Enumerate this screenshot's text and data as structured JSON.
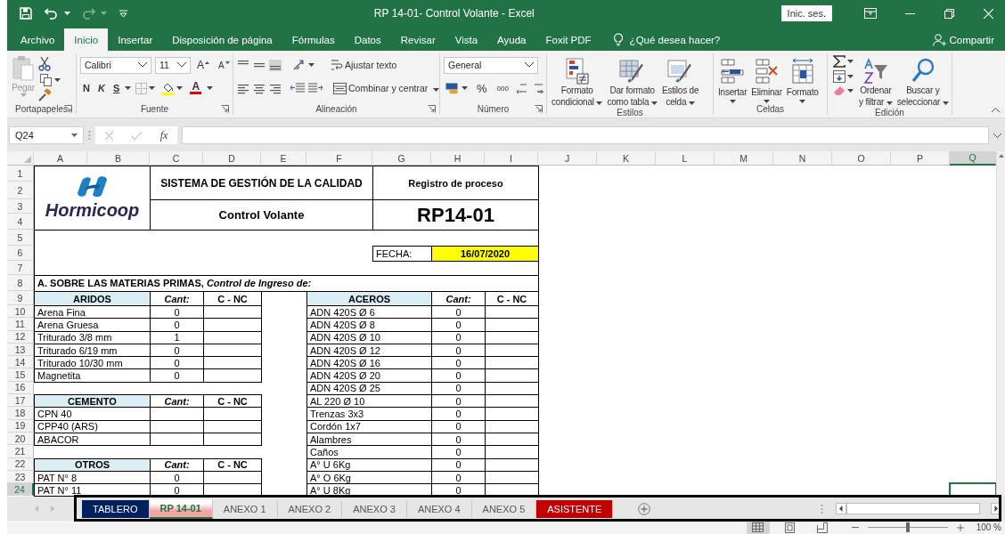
{
  "window": {
    "title": "RP 14-01- Control Volante  -  Excel",
    "sign_in": "Inic. ses."
  },
  "ribbon_tabs": [
    {
      "label": "Archivo",
      "selected": false
    },
    {
      "label": "Inicio",
      "selected": true
    },
    {
      "label": "Insertar",
      "selected": false
    },
    {
      "label": "Disposición de página",
      "selected": false
    },
    {
      "label": "Fórmulas",
      "selected": false
    },
    {
      "label": "Datos",
      "selected": false
    },
    {
      "label": "Revisar",
      "selected": false
    },
    {
      "label": "Vista",
      "selected": false
    },
    {
      "label": "Ayuda",
      "selected": false
    },
    {
      "label": "Foxit PDF",
      "selected": false
    }
  ],
  "tell_me": "¿Qué desea hacer?",
  "share": "Compartir",
  "ribbon": {
    "clipboard": {
      "label": "Portapapeles",
      "paste": "Pegar"
    },
    "font": {
      "label": "Fuente",
      "family": "Calibri",
      "size": "11",
      "grow": "A",
      "shrink": "A",
      "bold": "N",
      "italic": "K",
      "underline": "S",
      "color_letter": "A"
    },
    "alignment": {
      "label": "Alineación",
      "wrap": "Ajustar texto",
      "merge": "Combinar y centrar"
    },
    "number": {
      "label": "Número",
      "format": "General",
      "percent": "%",
      "thousands": "000"
    },
    "styles": {
      "label": "Estilos",
      "buttons": [
        {
          "lines": [
            "Formato",
            "condicional"
          ]
        },
        {
          "lines": [
            "Dar formato",
            "como tabla"
          ]
        },
        {
          "lines": [
            "Estilos de",
            "celda"
          ]
        }
      ]
    },
    "cells": {
      "label": "Celdas",
      "buttons": [
        "Insertar",
        "Eliminar",
        "Formato"
      ]
    },
    "editing": {
      "label": "Edición",
      "buttons": [
        {
          "lines": [
            "Ordenar",
            "y filtrar"
          ]
        },
        {
          "lines": [
            "Buscar y",
            "seleccionar"
          ]
        }
      ]
    }
  },
  "formula_bar": {
    "name_box": "Q24",
    "function_label": "fx"
  },
  "columns": [
    {
      "label": "A",
      "selected": false
    },
    {
      "label": "B",
      "selected": false
    },
    {
      "label": "C",
      "selected": false
    },
    {
      "label": "D",
      "selected": false
    },
    {
      "label": "E",
      "selected": false
    },
    {
      "label": "F",
      "selected": false
    },
    {
      "label": "G",
      "selected": false
    },
    {
      "label": "H",
      "selected": false
    },
    {
      "label": "I",
      "selected": false
    },
    {
      "label": "J",
      "selected": false
    },
    {
      "label": "K",
      "selected": false
    },
    {
      "label": "L",
      "selected": false
    },
    {
      "label": "M",
      "selected": false
    },
    {
      "label": "N",
      "selected": false
    },
    {
      "label": "O",
      "selected": false
    },
    {
      "label": "P",
      "selected": false
    },
    {
      "label": "Q",
      "selected": true
    }
  ],
  "row_numbers": [
    {
      "label": "1",
      "selected": false
    },
    {
      "label": "2",
      "selected": false
    },
    {
      "label": "3",
      "selected": false
    },
    {
      "label": "4",
      "selected": false
    },
    {
      "label": "5",
      "selected": false
    },
    {
      "label": "6",
      "selected": false
    },
    {
      "label": "7",
      "selected": false
    },
    {
      "label": "8",
      "selected": false
    },
    {
      "label": "9",
      "selected": false
    },
    {
      "label": "10",
      "selected": false
    },
    {
      "label": "11",
      "selected": false
    },
    {
      "label": "12",
      "selected": false
    },
    {
      "label": "13",
      "selected": false
    },
    {
      "label": "14",
      "selected": false
    },
    {
      "label": "15",
      "selected": false
    },
    {
      "label": "16",
      "selected": false
    },
    {
      "label": "17",
      "selected": false
    },
    {
      "label": "18",
      "selected": false
    },
    {
      "label": "19",
      "selected": false
    },
    {
      "label": "20",
      "selected": false
    },
    {
      "label": "21",
      "selected": false
    },
    {
      "label": "22",
      "selected": false
    },
    {
      "label": "23",
      "selected": false
    },
    {
      "label": "24",
      "selected": true
    }
  ],
  "form": {
    "logo_text": "Hormicoop",
    "title": "SISTEMA DE GESTIÓN DE LA CALIDAD",
    "record_label": "Registro de proceso",
    "subtitle": "Control Volante",
    "code": "RP14-01",
    "date_label": "FECHA:",
    "date": "16/07/2020",
    "section": "A. SOBRE LAS MATERIAS PRIMAS, *Control de Ingreso de:*",
    "left_tables": [
      {
        "title": "ARIDOS",
        "qty_header": "Cant:",
        "check_header": "C - NC",
        "rows": [
          {
            "name": "Arena Fina",
            "qty": "0"
          },
          {
            "name": "Arena Gruesa",
            "qty": "0"
          },
          {
            "name": "Triturado 3/8 mm",
            "qty": "1"
          },
          {
            "name": "Triturado 6/19 mm",
            "qty": "0"
          },
          {
            "name": "Triturado 10/30 mm",
            "qty": "0"
          },
          {
            "name": "Magnetita",
            "qty": "0"
          }
        ]
      },
      {
        "title": "CEMENTO",
        "qty_header": "Cant:",
        "check_header": "C - NC",
        "rows": [
          {
            "name": "CPN 40"
          },
          {
            "name": "CPP40 (ARS)"
          },
          {
            "name": "ABACOR"
          }
        ]
      },
      {
        "title": "OTROS",
        "qty_header": "Cant:",
        "check_header": "C - NC",
        "rows": [
          {
            "name": "PAT N° 8",
            "qty": "0"
          },
          {
            "name": "PAT N° 11",
            "qty": "0"
          }
        ]
      }
    ],
    "right_table": {
      "title": "ACEROS",
      "qty_header": "Cant:",
      "check_header": "C - NC",
      "rows": [
        {
          "name": "ADN 420S Ø 6",
          "qty": "0"
        },
        {
          "name": "ADN 420S Ø 8",
          "qty": "0"
        },
        {
          "name": "ADN 420S Ø 10",
          "qty": "0"
        },
        {
          "name": "ADN 420S Ø 12",
          "qty": "0"
        },
        {
          "name": "ADN 420S Ø 16",
          "qty": "0"
        },
        {
          "name": "ADN 420S Ø 20",
          "qty": "0"
        },
        {
          "name": "ADN 420S Ø 25",
          "qty": "0"
        },
        {
          "name": "AL 220 Ø 10",
          "qty": "0"
        },
        {
          "name": "Trenzas 3x3",
          "qty": "0"
        },
        {
          "name": "Cordón 1x7",
          "qty": "0"
        },
        {
          "name": "Alambres",
          "qty": "0"
        },
        {
          "name": "Caños",
          "qty": "0"
        },
        {
          "name": "A° U 6Kg",
          "qty": "0"
        },
        {
          "name": "A° O 6Kg",
          "qty": "0"
        },
        {
          "name": "A° U 8Kg",
          "qty": "0"
        }
      ]
    }
  },
  "sheet_tabs": [
    {
      "label": "TABLERO",
      "selected": false,
      "color": "#002060"
    },
    {
      "label": "RP 14-01",
      "selected": true,
      "color": "#f2a5a5"
    },
    {
      "label": "ANEXO 1",
      "selected": false
    },
    {
      "label": "ANEXO 2",
      "selected": false
    },
    {
      "label": "ANEXO 3",
      "selected": false
    },
    {
      "label": "ANEXO 4",
      "selected": false
    },
    {
      "label": "ANEXO 5",
      "selected": false
    },
    {
      "label": "ASISTENTE",
      "selected": false,
      "color": "#c00000"
    }
  ],
  "status_bar": {
    "views": [
      {
        "kind": "normal",
        "selected": true
      },
      {
        "kind": "page_layout",
        "selected": false
      },
      {
        "kind": "page_break",
        "selected": false
      }
    ],
    "zoom": {
      "level": 0.5,
      "reading": "100 %"
    }
  }
}
